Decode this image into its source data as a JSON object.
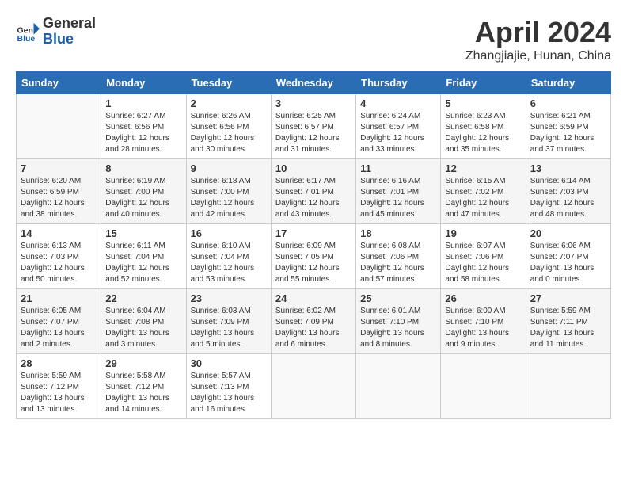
{
  "header": {
    "logo_line1": "General",
    "logo_line2": "Blue",
    "month_title": "April 2024",
    "location": "Zhangjiajie, Hunan, China"
  },
  "columns": [
    "Sunday",
    "Monday",
    "Tuesday",
    "Wednesday",
    "Thursday",
    "Friday",
    "Saturday"
  ],
  "weeks": [
    [
      {
        "day": "",
        "info": ""
      },
      {
        "day": "1",
        "info": "Sunrise: 6:27 AM\nSunset: 6:56 PM\nDaylight: 12 hours\nand 28 minutes."
      },
      {
        "day": "2",
        "info": "Sunrise: 6:26 AM\nSunset: 6:56 PM\nDaylight: 12 hours\nand 30 minutes."
      },
      {
        "day": "3",
        "info": "Sunrise: 6:25 AM\nSunset: 6:57 PM\nDaylight: 12 hours\nand 31 minutes."
      },
      {
        "day": "4",
        "info": "Sunrise: 6:24 AM\nSunset: 6:57 PM\nDaylight: 12 hours\nand 33 minutes."
      },
      {
        "day": "5",
        "info": "Sunrise: 6:23 AM\nSunset: 6:58 PM\nDaylight: 12 hours\nand 35 minutes."
      },
      {
        "day": "6",
        "info": "Sunrise: 6:21 AM\nSunset: 6:59 PM\nDaylight: 12 hours\nand 37 minutes."
      }
    ],
    [
      {
        "day": "7",
        "info": "Sunrise: 6:20 AM\nSunset: 6:59 PM\nDaylight: 12 hours\nand 38 minutes."
      },
      {
        "day": "8",
        "info": "Sunrise: 6:19 AM\nSunset: 7:00 PM\nDaylight: 12 hours\nand 40 minutes."
      },
      {
        "day": "9",
        "info": "Sunrise: 6:18 AM\nSunset: 7:00 PM\nDaylight: 12 hours\nand 42 minutes."
      },
      {
        "day": "10",
        "info": "Sunrise: 6:17 AM\nSunset: 7:01 PM\nDaylight: 12 hours\nand 43 minutes."
      },
      {
        "day": "11",
        "info": "Sunrise: 6:16 AM\nSunset: 7:01 PM\nDaylight: 12 hours\nand 45 minutes."
      },
      {
        "day": "12",
        "info": "Sunrise: 6:15 AM\nSunset: 7:02 PM\nDaylight: 12 hours\nand 47 minutes."
      },
      {
        "day": "13",
        "info": "Sunrise: 6:14 AM\nSunset: 7:03 PM\nDaylight: 12 hours\nand 48 minutes."
      }
    ],
    [
      {
        "day": "14",
        "info": "Sunrise: 6:13 AM\nSunset: 7:03 PM\nDaylight: 12 hours\nand 50 minutes."
      },
      {
        "day": "15",
        "info": "Sunrise: 6:11 AM\nSunset: 7:04 PM\nDaylight: 12 hours\nand 52 minutes."
      },
      {
        "day": "16",
        "info": "Sunrise: 6:10 AM\nSunset: 7:04 PM\nDaylight: 12 hours\nand 53 minutes."
      },
      {
        "day": "17",
        "info": "Sunrise: 6:09 AM\nSunset: 7:05 PM\nDaylight: 12 hours\nand 55 minutes."
      },
      {
        "day": "18",
        "info": "Sunrise: 6:08 AM\nSunset: 7:06 PM\nDaylight: 12 hours\nand 57 minutes."
      },
      {
        "day": "19",
        "info": "Sunrise: 6:07 AM\nSunset: 7:06 PM\nDaylight: 12 hours\nand 58 minutes."
      },
      {
        "day": "20",
        "info": "Sunrise: 6:06 AM\nSunset: 7:07 PM\nDaylight: 13 hours\nand 0 minutes."
      }
    ],
    [
      {
        "day": "21",
        "info": "Sunrise: 6:05 AM\nSunset: 7:07 PM\nDaylight: 13 hours\nand 2 minutes."
      },
      {
        "day": "22",
        "info": "Sunrise: 6:04 AM\nSunset: 7:08 PM\nDaylight: 13 hours\nand 3 minutes."
      },
      {
        "day": "23",
        "info": "Sunrise: 6:03 AM\nSunset: 7:09 PM\nDaylight: 13 hours\nand 5 minutes."
      },
      {
        "day": "24",
        "info": "Sunrise: 6:02 AM\nSunset: 7:09 PM\nDaylight: 13 hours\nand 6 minutes."
      },
      {
        "day": "25",
        "info": "Sunrise: 6:01 AM\nSunset: 7:10 PM\nDaylight: 13 hours\nand 8 minutes."
      },
      {
        "day": "26",
        "info": "Sunrise: 6:00 AM\nSunset: 7:10 PM\nDaylight: 13 hours\nand 9 minutes."
      },
      {
        "day": "27",
        "info": "Sunrise: 5:59 AM\nSunset: 7:11 PM\nDaylight: 13 hours\nand 11 minutes."
      }
    ],
    [
      {
        "day": "28",
        "info": "Sunrise: 5:59 AM\nSunset: 7:12 PM\nDaylight: 13 hours\nand 13 minutes."
      },
      {
        "day": "29",
        "info": "Sunrise: 5:58 AM\nSunset: 7:12 PM\nDaylight: 13 hours\nand 14 minutes."
      },
      {
        "day": "30",
        "info": "Sunrise: 5:57 AM\nSunset: 7:13 PM\nDaylight: 13 hours\nand 16 minutes."
      },
      {
        "day": "",
        "info": ""
      },
      {
        "day": "",
        "info": ""
      },
      {
        "day": "",
        "info": ""
      },
      {
        "day": "",
        "info": ""
      }
    ]
  ]
}
